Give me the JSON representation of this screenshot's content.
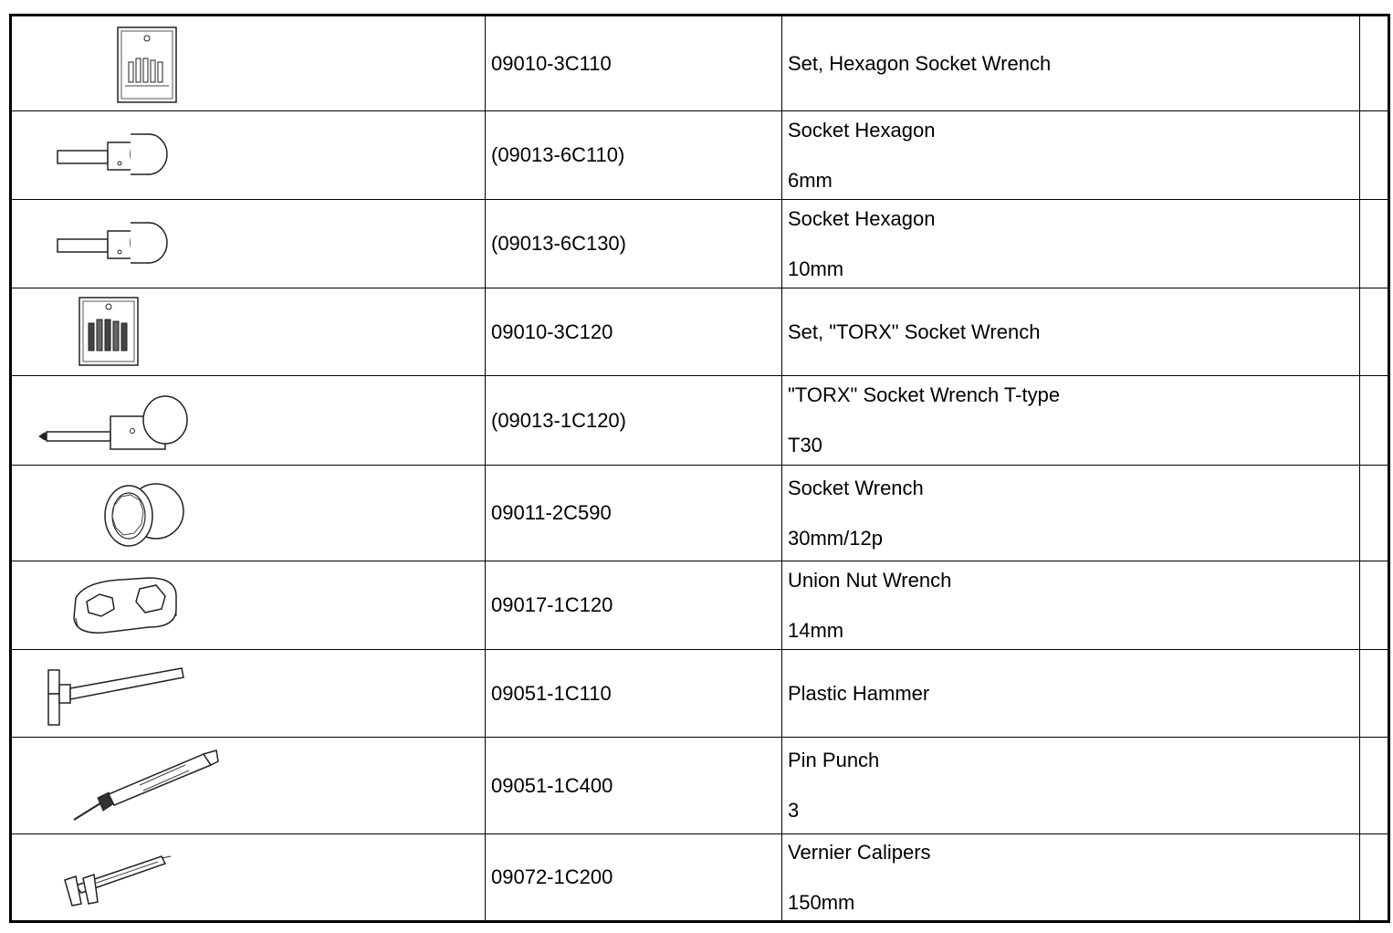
{
  "tools": [
    {
      "icon": "hexagon-socket-set-icon",
      "part_number": "09010-3C110",
      "description": "Set, Hexagon Socket Wrench",
      "spec": ""
    },
    {
      "icon": "socket-hexagon-icon",
      "part_number": "(09013-6C110)",
      "description": "Socket Hexagon",
      "spec": "6mm"
    },
    {
      "icon": "socket-hexagon-icon",
      "part_number": "(09013-6C130)",
      "description": "Socket Hexagon",
      "spec": "10mm"
    },
    {
      "icon": "torx-socket-set-icon",
      "part_number": "09010-3C120",
      "description": "Set, \"TORX\" Socket Wrench",
      "spec": ""
    },
    {
      "icon": "torx-socket-icon",
      "part_number": "(09013-1C120)",
      "description": "\"TORX\" Socket Wrench T-type",
      "spec": "T30"
    },
    {
      "icon": "socket-wrench-icon",
      "part_number": "09011-2C590",
      "description": "Socket Wrench",
      "spec": "30mm/12p"
    },
    {
      "icon": "union-nut-wrench-icon",
      "part_number": "09017-1C120",
      "description": "Union Nut Wrench",
      "spec": "14mm"
    },
    {
      "icon": "plastic-hammer-icon",
      "part_number": "09051-1C110",
      "description": "Plastic Hammer",
      "spec": ""
    },
    {
      "icon": "pin-punch-icon",
      "part_number": "09051-1C400",
      "description": "Pin Punch",
      "spec": "3"
    },
    {
      "icon": "vernier-calipers-icon",
      "part_number": "09072-1C200",
      "description": "Vernier Calipers",
      "spec": "150mm"
    }
  ]
}
